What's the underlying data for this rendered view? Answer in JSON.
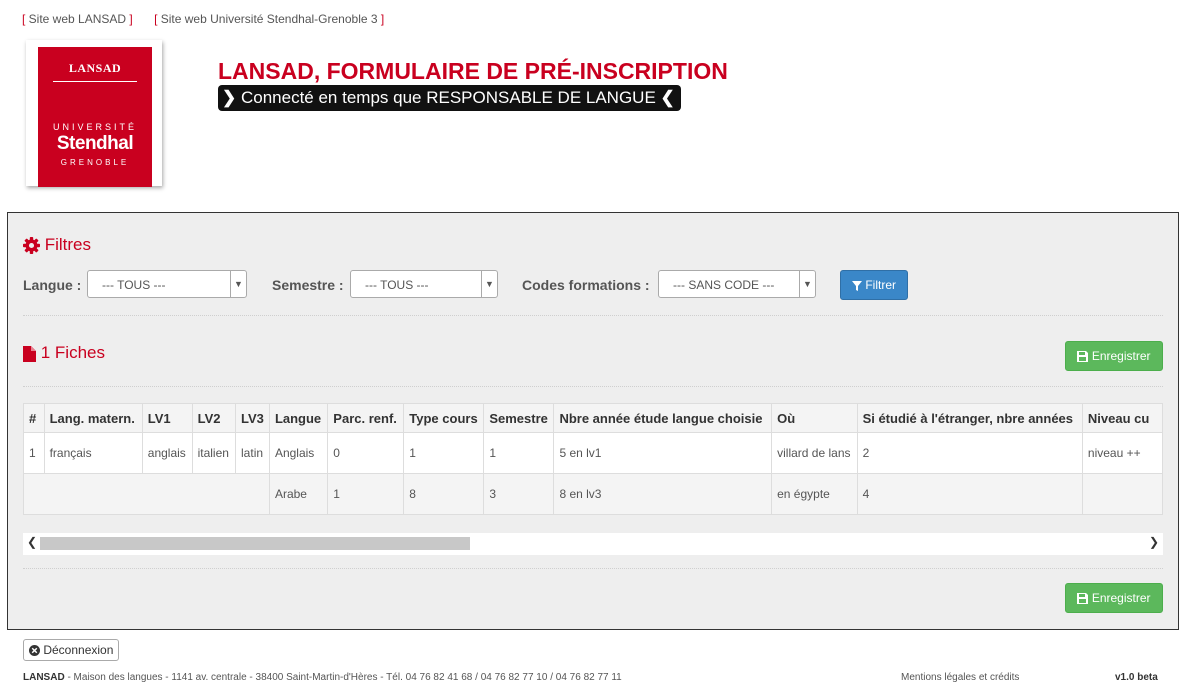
{
  "top_links": [
    {
      "label": "Site web LANSAD"
    },
    {
      "label": "Site web Université Stendhal-Grenoble 3"
    }
  ],
  "logo": {
    "line1": "LANSAD",
    "line2": "UNIVERSITÉ",
    "line3": "Stendhal",
    "line4": "GRENOBLE"
  },
  "header": {
    "title": "LANSAD, FORMULAIRE DE PRÉ-INSCRIPTION",
    "badge": "Connecté en temps que RESPONSABLE DE LANGUE"
  },
  "filters": {
    "title": "Filtres",
    "langue_label": "Langue :",
    "langue_value": "--- TOUS ---",
    "semestre_label": "Semestre :",
    "semestre_value": "--- TOUS ---",
    "codes_label": "Codes formations :",
    "codes_value": "--- SANS CODE ---",
    "button": "Filtrer"
  },
  "fiches": {
    "title": "1 Fiches",
    "save_label": "Enregistrer"
  },
  "table": {
    "headers": [
      "#",
      "Lang. matern.",
      "LV1",
      "LV2",
      "LV3",
      "Langue",
      "Parc. renf.",
      "Type cours",
      "Semestre",
      "Nbre année étude langue choisie",
      "Où",
      "Si étudié à l'étranger, nbre années",
      "Niveau cu"
    ],
    "rows": [
      [
        "1",
        "français",
        "anglais",
        "italien",
        "latin",
        "Anglais",
        "0",
        "1",
        "1",
        "5 en lv1",
        "villard de lans",
        "2",
        "niveau ++"
      ],
      [
        "",
        "",
        "",
        "",
        "",
        "Arabe",
        "1",
        "8",
        "3",
        "8 en lv3",
        "en égypte",
        "4",
        ""
      ]
    ]
  },
  "logout": "Déconnexion",
  "footer": {
    "org": "LANSAD",
    "address": " - Maison des langues - 1141 av. centrale - 38400 Saint-Martin-d'Hères - Tél. 04 76 82 41 68 / 04 76 82 77 10 / 04 76 82 77 11",
    "mentions": "Mentions légales et crédits",
    "version": "v1.0 beta"
  },
  "colors": {
    "brand_red": "#c9001f",
    "primary_blue": "#3a87c8",
    "success_green": "#5cb85c"
  }
}
